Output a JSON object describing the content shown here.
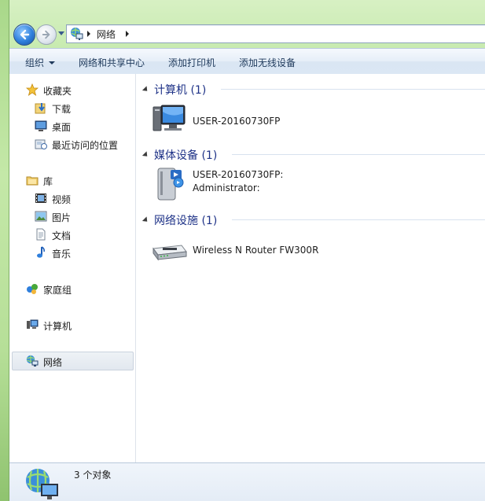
{
  "address": {
    "segments": [
      "网络"
    ]
  },
  "toolbar": {
    "organize": "组织",
    "network_center": "网络和共享中心",
    "add_printer": "添加打印机",
    "add_wireless": "添加无线设备"
  },
  "sidebar": {
    "favorites": {
      "label": "收藏夹",
      "items": [
        {
          "label": "下载"
        },
        {
          "label": "桌面"
        },
        {
          "label": "最近访问的位置"
        }
      ]
    },
    "libraries": {
      "label": "库",
      "items": [
        {
          "label": "视频"
        },
        {
          "label": "图片"
        },
        {
          "label": "文档"
        },
        {
          "label": "音乐"
        }
      ]
    },
    "homegroup": "家庭组",
    "computer": "计算机",
    "network": "网络"
  },
  "groups": [
    {
      "title": "计算机 (1)",
      "items": [
        {
          "line1": "USER-20160730FP",
          "icon": "computer-icon"
        }
      ]
    },
    {
      "title": "媒体设备 (1)",
      "items": [
        {
          "line1": "USER-20160730FP:",
          "line2": "Administrator:",
          "icon": "media-server-icon"
        }
      ]
    },
    {
      "title": "网络设施 (1)",
      "items": [
        {
          "line1": "Wireless N Router FW300R",
          "icon": "router-icon"
        }
      ]
    }
  ],
  "status": {
    "count": "3 个对象"
  }
}
